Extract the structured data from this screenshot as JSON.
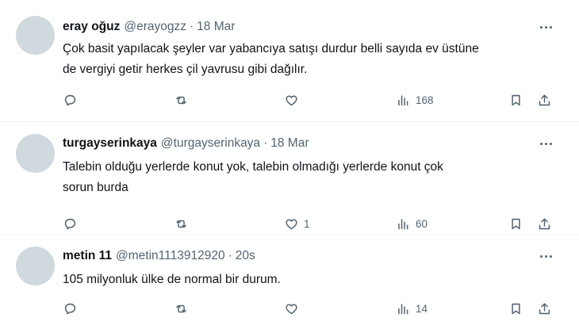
{
  "tweets": [
    {
      "name": "eray oğuz",
      "handle": "@erayogzz",
      "time": "18 Mar",
      "text_lines": [
        "Çok basit yapılacak şeyler var yabancıya satışı durdur belli sayıda ev üstüne",
        "de vergiyi getir herkes çil yavrusu gibi dağılır."
      ],
      "likes": "",
      "views": "168"
    },
    {
      "name": "turgayserinkaya",
      "handle": "@turgayserinkaya",
      "time": "18 Mar",
      "text_lines": [
        "Talebin olduğu yerlerde konut yok, talebin olmadığı yerlerde konut çok",
        "sorun burda"
      ],
      "likes": "1",
      "views": "60"
    },
    {
      "name": "metin 11",
      "handle": "@metin1113912920",
      "time": "20s",
      "text_lines": [
        "105 milyonluk ülke de normal bir durum."
      ],
      "likes": "",
      "views": "14"
    }
  ],
  "separator": "·",
  "icons": {
    "more": "more-dots-icon",
    "reply": "reply-bubble-icon",
    "retweet": "retweet-icon",
    "like": "heart-icon",
    "views": "views-bar-chart-icon",
    "bookmark": "bookmark-icon",
    "share": "share-upload-icon"
  },
  "colors": {
    "text": "#0f1419",
    "secondary": "#536471",
    "avatar": "#cfd9de",
    "divider": "#eff3f4"
  }
}
